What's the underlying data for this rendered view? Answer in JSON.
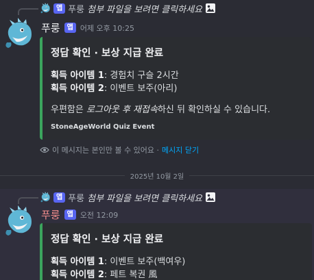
{
  "messages": [
    {
      "reply": {
        "name": "푸룽",
        "badge": "앱",
        "text": "첨부 파일을 보려면 클릭하세요"
      },
      "author": {
        "name": "푸룽",
        "badge": "앱",
        "time": "어제 오후 10:25"
      },
      "embed": {
        "title": "정답 확인 · 보상 지급 완료",
        "item1_label": "획득 아이템 1",
        "item1_value": ": 경험치 구슬 2시간",
        "item2_label": "획득 아이템 2",
        "item2_value": ": 이벤트 보주(아리)",
        "notice_pre": "우편함은 ",
        "notice_em": "로그아웃 후 재접속",
        "notice_post": "하신 뒤 확인하실 수 있습니다.",
        "footer": "StoneAgeWorld Quiz Event"
      },
      "ephemeral": {
        "text": "이 메시지는 본인만 볼 수 있어요 · ",
        "link": "메시지 닫기"
      }
    },
    {
      "reply": {
        "name": "푸룽",
        "badge": "앱",
        "text": "첨부 파일을 보려면 클릭하세요"
      },
      "author": {
        "name": "푸룽",
        "badge": "앱",
        "time": "오전 12:09"
      },
      "embed": {
        "title": "정답 확인 · 보상 지급 완료",
        "item1_label": "획득 아이템 1",
        "item1_value": ": 이벤트 보주(백여우)",
        "item2_label": "획득 아이템 2",
        "item2_value": ": 페트 복권 風"
      }
    }
  ],
  "date_divider": "2025년 10월 2일",
  "colors": {
    "accent": "#3ba55d",
    "badge": "#5865f2",
    "link": "#00a8fc"
  }
}
